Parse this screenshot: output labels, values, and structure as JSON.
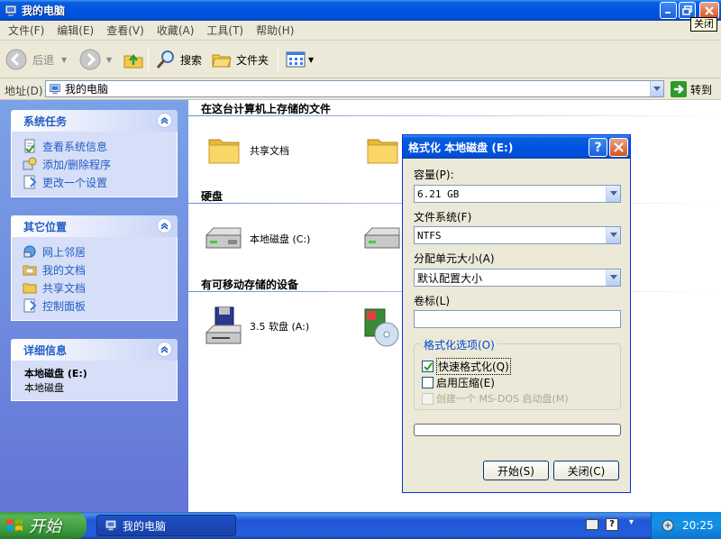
{
  "window": {
    "title": "我的电脑",
    "close_tooltip": "关闭"
  },
  "menu": [
    "文件(F)",
    "编辑(E)",
    "查看(V)",
    "收藏(A)",
    "工具(T)",
    "帮助(H)"
  ],
  "toolbar": {
    "back": "后退",
    "search": "搜索",
    "folders": "文件夹"
  },
  "address": {
    "label": "地址(D)",
    "value": "我的电脑",
    "go": "转到"
  },
  "tasks_panel": {
    "title": "系统任务",
    "items": [
      "查看系统信息",
      "添加/删除程序",
      "更改一个设置"
    ]
  },
  "places_panel": {
    "title": "其它位置",
    "items": [
      "网上邻居",
      "我的文档",
      "共享文档",
      "控制面板"
    ]
  },
  "details_panel": {
    "title": "详细信息",
    "name": "本地磁盘 (E:)",
    "type": "本地磁盘"
  },
  "content": {
    "group_files": "在这台计算机上存储的文件",
    "shared_docs": "共享文档",
    "group_disks": "硬盘",
    "disk_c": "本地磁盘 (C:)",
    "group_removable": "有可移动存储的设备",
    "floppy": "3.5 软盘 (A:)"
  },
  "dialog": {
    "title": "格式化 本地磁盘 (E:)",
    "capacity_label": "容量(P):",
    "capacity_value": "6.21 GB",
    "fs_label": "文件系统(F)",
    "fs_value": "NTFS",
    "alloc_label": "分配单元大小(A)",
    "alloc_value": "默认配置大小",
    "volume_label": "卷标(L)",
    "volume_value": "",
    "options_title": "格式化选项(O)",
    "opt_quick": "快速格式化(Q)",
    "opt_quick_checked": true,
    "opt_compress": "启用压缩(E)",
    "opt_compress_checked": false,
    "opt_msdos": "创建一个 MS-DOS 启动盘(M)",
    "opt_msdos_enabled": false,
    "progress": 0,
    "start_button": "开始(S)",
    "close_button": "关闭(C)"
  },
  "taskbar": {
    "start": "开始",
    "task": "我的电脑",
    "clock": "20:25"
  }
}
